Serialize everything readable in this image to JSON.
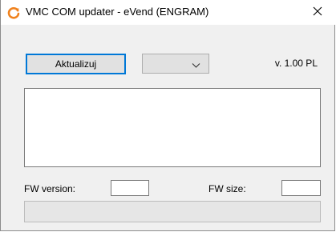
{
  "window": {
    "title": "VMC COM updater - eVend (ENGRAM)",
    "app_icon": "orange-refresh-icon",
    "close_icon": "close-icon"
  },
  "toolbar": {
    "update_label": "Aktualizuj",
    "port_select_value": "",
    "version_label": "v. 1.00 PL"
  },
  "log": {
    "text": ""
  },
  "firmware": {
    "version_label": "FW version:",
    "version_value": "",
    "size_label": "FW size:",
    "size_value": ""
  },
  "progress": {
    "value": 0
  },
  "colors": {
    "accent": "#0078d7",
    "icon_orange": "#f0821e",
    "window_bg": "#f0f0f0"
  }
}
